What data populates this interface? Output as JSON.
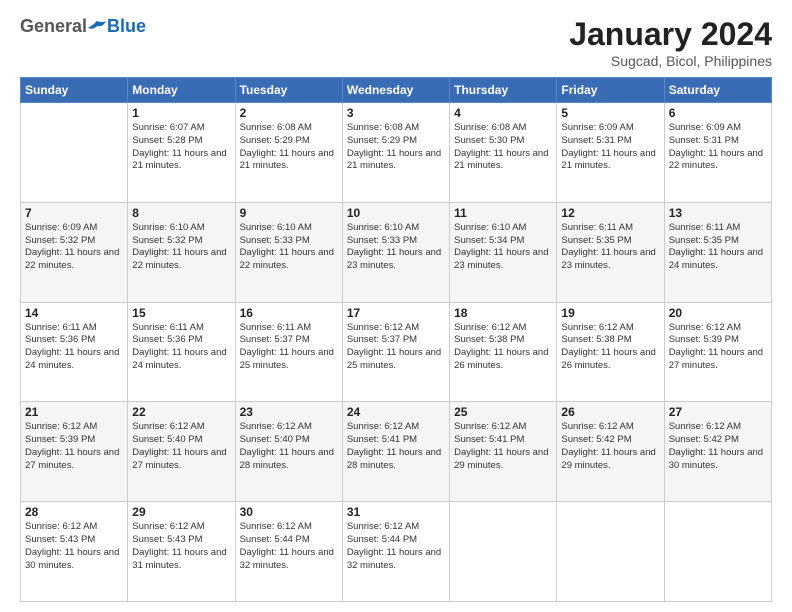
{
  "logo": {
    "general": "General",
    "blue": "Blue"
  },
  "title": "January 2024",
  "subtitle": "Sugcad, Bicol, Philippines",
  "days_of_week": [
    "Sunday",
    "Monday",
    "Tuesday",
    "Wednesday",
    "Thursday",
    "Friday",
    "Saturday"
  ],
  "weeks": [
    [
      {
        "day": "",
        "sunrise": "",
        "sunset": "",
        "daylight": ""
      },
      {
        "day": "1",
        "sunrise": "Sunrise: 6:07 AM",
        "sunset": "Sunset: 5:28 PM",
        "daylight": "Daylight: 11 hours and 21 minutes."
      },
      {
        "day": "2",
        "sunrise": "Sunrise: 6:08 AM",
        "sunset": "Sunset: 5:29 PM",
        "daylight": "Daylight: 11 hours and 21 minutes."
      },
      {
        "day": "3",
        "sunrise": "Sunrise: 6:08 AM",
        "sunset": "Sunset: 5:29 PM",
        "daylight": "Daylight: 11 hours and 21 minutes."
      },
      {
        "day": "4",
        "sunrise": "Sunrise: 6:08 AM",
        "sunset": "Sunset: 5:30 PM",
        "daylight": "Daylight: 11 hours and 21 minutes."
      },
      {
        "day": "5",
        "sunrise": "Sunrise: 6:09 AM",
        "sunset": "Sunset: 5:31 PM",
        "daylight": "Daylight: 11 hours and 21 minutes."
      },
      {
        "day": "6",
        "sunrise": "Sunrise: 6:09 AM",
        "sunset": "Sunset: 5:31 PM",
        "daylight": "Daylight: 11 hours and 22 minutes."
      }
    ],
    [
      {
        "day": "7",
        "sunrise": "Sunrise: 6:09 AM",
        "sunset": "Sunset: 5:32 PM",
        "daylight": "Daylight: 11 hours and 22 minutes."
      },
      {
        "day": "8",
        "sunrise": "Sunrise: 6:10 AM",
        "sunset": "Sunset: 5:32 PM",
        "daylight": "Daylight: 11 hours and 22 minutes."
      },
      {
        "day": "9",
        "sunrise": "Sunrise: 6:10 AM",
        "sunset": "Sunset: 5:33 PM",
        "daylight": "Daylight: 11 hours and 22 minutes."
      },
      {
        "day": "10",
        "sunrise": "Sunrise: 6:10 AM",
        "sunset": "Sunset: 5:33 PM",
        "daylight": "Daylight: 11 hours and 23 minutes."
      },
      {
        "day": "11",
        "sunrise": "Sunrise: 6:10 AM",
        "sunset": "Sunset: 5:34 PM",
        "daylight": "Daylight: 11 hours and 23 minutes."
      },
      {
        "day": "12",
        "sunrise": "Sunrise: 6:11 AM",
        "sunset": "Sunset: 5:35 PM",
        "daylight": "Daylight: 11 hours and 23 minutes."
      },
      {
        "day": "13",
        "sunrise": "Sunrise: 6:11 AM",
        "sunset": "Sunset: 5:35 PM",
        "daylight": "Daylight: 11 hours and 24 minutes."
      }
    ],
    [
      {
        "day": "14",
        "sunrise": "Sunrise: 6:11 AM",
        "sunset": "Sunset: 5:36 PM",
        "daylight": "Daylight: 11 hours and 24 minutes."
      },
      {
        "day": "15",
        "sunrise": "Sunrise: 6:11 AM",
        "sunset": "Sunset: 5:36 PM",
        "daylight": "Daylight: 11 hours and 24 minutes."
      },
      {
        "day": "16",
        "sunrise": "Sunrise: 6:11 AM",
        "sunset": "Sunset: 5:37 PM",
        "daylight": "Daylight: 11 hours and 25 minutes."
      },
      {
        "day": "17",
        "sunrise": "Sunrise: 6:12 AM",
        "sunset": "Sunset: 5:37 PM",
        "daylight": "Daylight: 11 hours and 25 minutes."
      },
      {
        "day": "18",
        "sunrise": "Sunrise: 6:12 AM",
        "sunset": "Sunset: 5:38 PM",
        "daylight": "Daylight: 11 hours and 26 minutes."
      },
      {
        "day": "19",
        "sunrise": "Sunrise: 6:12 AM",
        "sunset": "Sunset: 5:38 PM",
        "daylight": "Daylight: 11 hours and 26 minutes."
      },
      {
        "day": "20",
        "sunrise": "Sunrise: 6:12 AM",
        "sunset": "Sunset: 5:39 PM",
        "daylight": "Daylight: 11 hours and 27 minutes."
      }
    ],
    [
      {
        "day": "21",
        "sunrise": "Sunrise: 6:12 AM",
        "sunset": "Sunset: 5:39 PM",
        "daylight": "Daylight: 11 hours and 27 minutes."
      },
      {
        "day": "22",
        "sunrise": "Sunrise: 6:12 AM",
        "sunset": "Sunset: 5:40 PM",
        "daylight": "Daylight: 11 hours and 27 minutes."
      },
      {
        "day": "23",
        "sunrise": "Sunrise: 6:12 AM",
        "sunset": "Sunset: 5:40 PM",
        "daylight": "Daylight: 11 hours and 28 minutes."
      },
      {
        "day": "24",
        "sunrise": "Sunrise: 6:12 AM",
        "sunset": "Sunset: 5:41 PM",
        "daylight": "Daylight: 11 hours and 28 minutes."
      },
      {
        "day": "25",
        "sunrise": "Sunrise: 6:12 AM",
        "sunset": "Sunset: 5:41 PM",
        "daylight": "Daylight: 11 hours and 29 minutes."
      },
      {
        "day": "26",
        "sunrise": "Sunrise: 6:12 AM",
        "sunset": "Sunset: 5:42 PM",
        "daylight": "Daylight: 11 hours and 29 minutes."
      },
      {
        "day": "27",
        "sunrise": "Sunrise: 6:12 AM",
        "sunset": "Sunset: 5:42 PM",
        "daylight": "Daylight: 11 hours and 30 minutes."
      }
    ],
    [
      {
        "day": "28",
        "sunrise": "Sunrise: 6:12 AM",
        "sunset": "Sunset: 5:43 PM",
        "daylight": "Daylight: 11 hours and 30 minutes."
      },
      {
        "day": "29",
        "sunrise": "Sunrise: 6:12 AM",
        "sunset": "Sunset: 5:43 PM",
        "daylight": "Daylight: 11 hours and 31 minutes."
      },
      {
        "day": "30",
        "sunrise": "Sunrise: 6:12 AM",
        "sunset": "Sunset: 5:44 PM",
        "daylight": "Daylight: 11 hours and 32 minutes."
      },
      {
        "day": "31",
        "sunrise": "Sunrise: 6:12 AM",
        "sunset": "Sunset: 5:44 PM",
        "daylight": "Daylight: 11 hours and 32 minutes."
      },
      {
        "day": "",
        "sunrise": "",
        "sunset": "",
        "daylight": ""
      },
      {
        "day": "",
        "sunrise": "",
        "sunset": "",
        "daylight": ""
      },
      {
        "day": "",
        "sunrise": "",
        "sunset": "",
        "daylight": ""
      }
    ]
  ]
}
